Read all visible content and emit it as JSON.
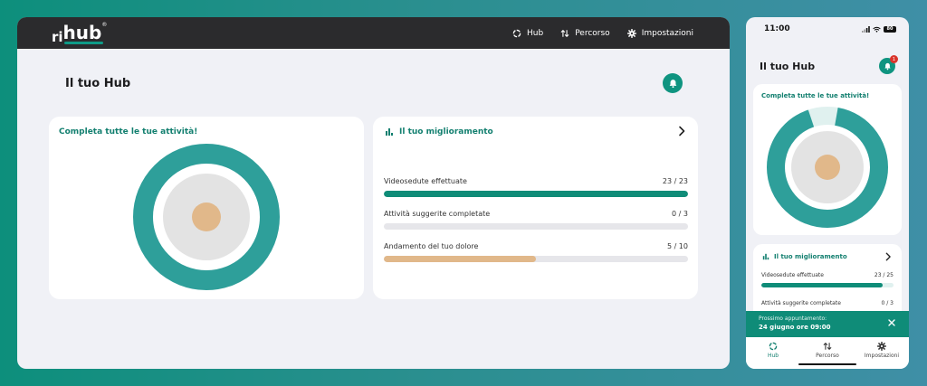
{
  "colors": {
    "accent": "#0f9480",
    "ring_outer": "#2e9f9a",
    "ring_mid": "#e3e3e3",
    "ring_inner": "#e1b88a",
    "bar_track": "#e6e6ea",
    "bar_green": "#0f8c78",
    "bar_tan": "#e1b88a"
  },
  "brand": {
    "prefix": "ri",
    "name": "hub",
    "reg": "®"
  },
  "nav": [
    {
      "label": "Hub",
      "icon": "loader-icon"
    },
    {
      "label": "Percorso",
      "icon": "swap-icon"
    },
    {
      "label": "Impostazioni",
      "icon": "gear-icon"
    }
  ],
  "page": {
    "title": "Il tuo Hub"
  },
  "activities": {
    "title": "Completa tutte le tue attività!"
  },
  "improvement": {
    "title": "Il tuo miglioramento",
    "metrics": [
      {
        "label": "Videosedute effettuate",
        "value": "23 / 23",
        "fraction": 1.0,
        "color": "#0f8c78"
      },
      {
        "label": "Attività suggerite completate",
        "value": "0 / 3",
        "fraction": 0.0,
        "color": "#0f8c78"
      },
      {
        "label": "Andamento del tuo dolore",
        "value": "5 / 10",
        "fraction": 0.5,
        "color": "#e1b88a"
      }
    ]
  },
  "phone": {
    "time": "11:00",
    "battery": "80",
    "title": "Il tuo Hub",
    "badge_count": "1",
    "activities_title": "Completa tutte le tue attività!",
    "ring_progress": 0.92,
    "improvement_title": "Il tuo miglioramento",
    "metrics": [
      {
        "label": "Videosedute effettuate",
        "value": "23 / 25",
        "fraction": 0.92
      },
      {
        "label": "Attività suggerite completate",
        "value": "0 / 3",
        "fraction": 0.0
      }
    ],
    "toast": {
      "line1": "Prossimo appuntamento:",
      "line2": "24 giugno ore 09:00"
    },
    "tabs": [
      {
        "label": "Hub",
        "icon": "loader-icon",
        "active": true
      },
      {
        "label": "Percorso",
        "icon": "swap-icon",
        "active": false
      },
      {
        "label": "Impostazioni",
        "icon": "gear-icon",
        "active": false
      }
    ]
  }
}
